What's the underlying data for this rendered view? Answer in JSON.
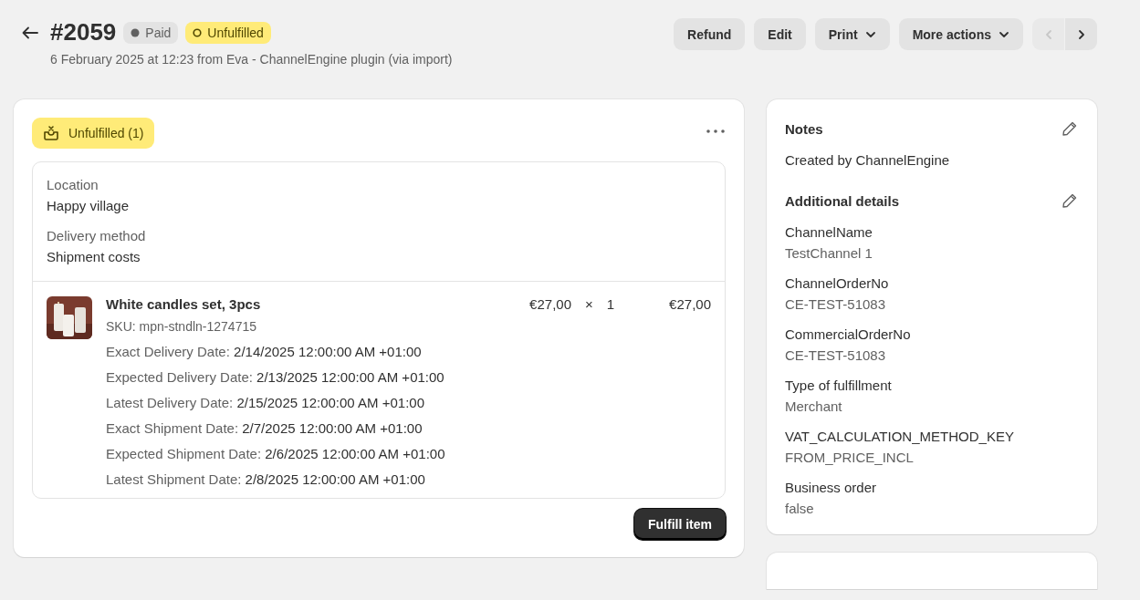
{
  "header": {
    "order_number": "#2059",
    "badges": [
      {
        "label": "Paid",
        "kind": "payment"
      },
      {
        "label": "Unfulfilled",
        "kind": "fulfillment"
      }
    ],
    "subtitle": "6 February 2025 at 12:23 from Eva - ChannelEngine plugin (via import)",
    "actions": [
      {
        "label": "Refund",
        "dropdown": false
      },
      {
        "label": "Edit",
        "dropdown": false
      },
      {
        "label": "Print",
        "dropdown": true
      },
      {
        "label": "More actions",
        "dropdown": true
      }
    ],
    "pager": {
      "previous_disabled": true,
      "next_disabled": false
    }
  },
  "fulfillment_card": {
    "status": "Unfulfilled (1)",
    "fields": [
      {
        "label": "Location",
        "value": "Happy village"
      },
      {
        "label": "Delivery method",
        "value": "Shipment costs"
      }
    ],
    "line_item": {
      "kind": "picture",
      "title": "White candles set, 3pcs",
      "sku": "SKU: mpn-stndln-1274715",
      "price": "€27,00",
      "times": "×",
      "quantity": "1",
      "total": "€27,00",
      "properties": [
        {
          "label": "Exact Delivery Date:",
          "value": "2/14/2025 12:00:00 AM +01:00"
        },
        {
          "label": "Expected Delivery Date:",
          "value": "2/13/2025 12:00:00 AM +01:00"
        },
        {
          "label": "Latest Delivery Date:",
          "value": "2/15/2025 12:00:00 AM +01:00"
        },
        {
          "label": "Exact Shipment Date:",
          "value": "2/7/2025 12:00:00 AM +01:00"
        },
        {
          "label": "Expected Shipment Date:",
          "value": "2/6/2025 12:00:00 AM +01:00"
        },
        {
          "label": "Latest Shipment Date:",
          "value": "2/8/2025 12:00:00 AM +01:00"
        }
      ]
    },
    "button": "Fulfill item"
  },
  "notes": {
    "title": "Notes",
    "text": "Created by ChannelEngine"
  },
  "additional_details": {
    "title": "Additional details",
    "items": [
      {
        "label": "ChannelName",
        "value": "TestChannel 1"
      },
      {
        "label": "ChannelOrderNo",
        "value": "CE-TEST-51083"
      },
      {
        "label": "CommercialOrderNo",
        "value": "CE-TEST-51083"
      },
      {
        "label": "Type of fulfillment",
        "value": "Merchant"
      },
      {
        "label": "VAT_CALCULATION_METHOD_KEY",
        "value": "FROM_PRICE_INCL"
      },
      {
        "label": "Business order",
        "value": "false"
      }
    ]
  }
}
